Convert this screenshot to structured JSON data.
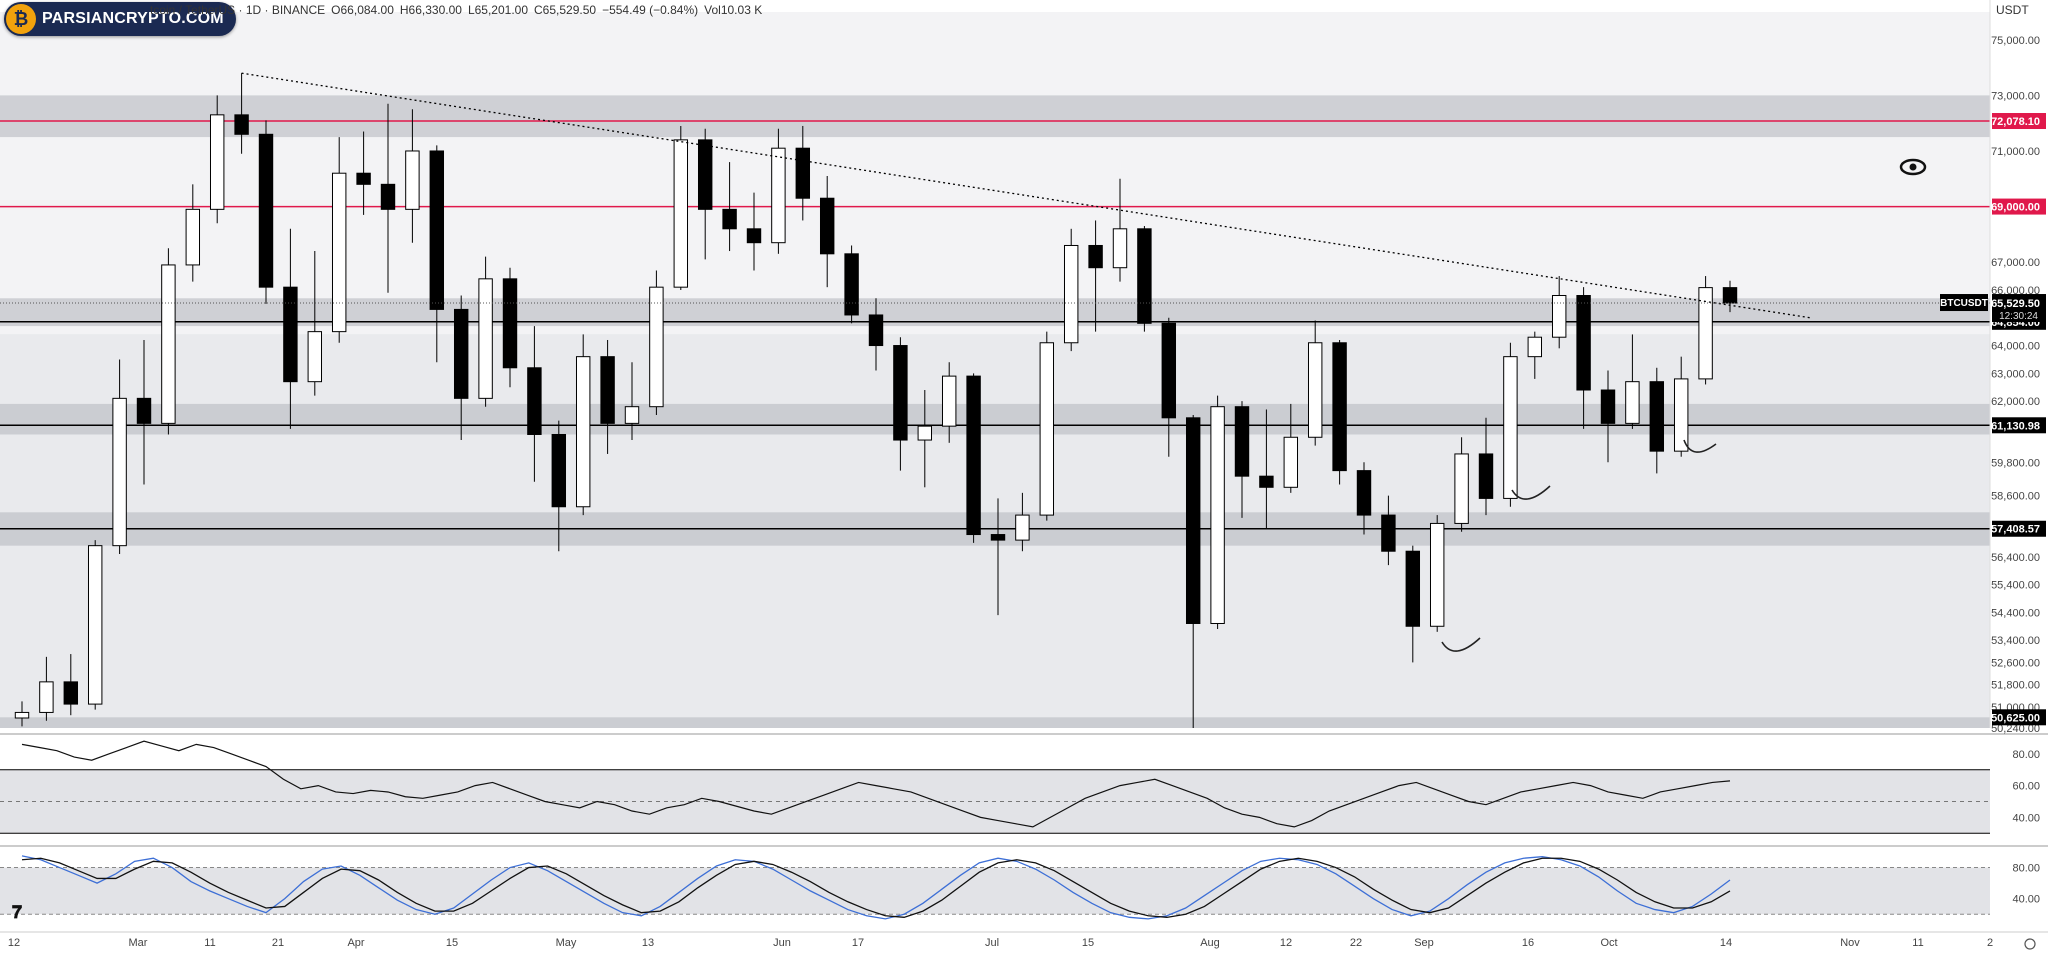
{
  "header": {
    "symbol": "tcoin / TetherUS · 1D · BINANCE",
    "open": "O66,084.00",
    "high": "H66,330.00",
    "low": "L65,201.00",
    "close": "C65,529.50",
    "change": "−554.49 (−0.84%)",
    "volume": "Vol10.03 K",
    "currency": "USDT"
  },
  "watermark": {
    "text": "PARSIANCRYPTO.COM"
  },
  "colors": {
    "up": "#ffffff",
    "down": "#000000",
    "red_line": "#e0184b",
    "zone": "#b8b9bf",
    "blue": "#3d6fd6"
  },
  "icons": {
    "eye": "eye-icon",
    "logo": "tradingview-logo-icon",
    "settings": "settings-icon"
  },
  "chart_data": [
    {
      "type": "candlestick",
      "symbol": "BTCUSDT",
      "timeframe": "1D",
      "ylim": [
        50240,
        76000
      ],
      "y_ticks": [
        "75,000.00",
        "73,000.00",
        "71,000.00",
        "67,000.00",
        "66,000.00",
        "64,000.00",
        "63,000.00",
        "62,000.00",
        "59,800.00",
        "58,600.00",
        "56,400.00",
        "55,400.00",
        "54,400.00",
        "53,400.00",
        "52,600.00",
        "51,800.00",
        "51,000.00",
        "50,240.00"
      ],
      "x_ticks": [
        "12",
        "Mar",
        "11",
        "21",
        "Apr",
        "15",
        "May",
        "13",
        "Jun",
        "17",
        "Jul",
        "15",
        "Aug",
        "12",
        "22",
        "Sep",
        "16",
        "Oct",
        "14",
        "Nov",
        "11",
        "2"
      ],
      "price_labels": [
        {
          "value": 72078.1,
          "text": "72,078.10",
          "style": "red"
        },
        {
          "value": 69000.0,
          "text": "69,000.00",
          "style": "red"
        },
        {
          "value": 64854.0,
          "text": "64,854.00",
          "style": "black"
        },
        {
          "value": 61130.98,
          "text": "61,130.98",
          "style": "black"
        },
        {
          "value": 57408.57,
          "text": "57,408.57",
          "style": "black"
        },
        {
          "value": 50625.0,
          "text": "50,625.00",
          "style": "black"
        }
      ],
      "current_price": {
        "symbol": "BTCUSDT",
        "value": 65529.5,
        "text": "65,529.50",
        "countdown": "12:30:24"
      },
      "horizontal_lines": [
        {
          "value": 72078.1,
          "color": "red"
        },
        {
          "value": 69000.0,
          "color": "red"
        },
        {
          "value": 64854.0,
          "color": "black"
        },
        {
          "value": 61130.98,
          "color": "black"
        },
        {
          "value": 57408.57,
          "color": "black"
        }
      ],
      "zones": [
        {
          "from": 71500,
          "to": 73000
        },
        {
          "from": 64700,
          "to": 65700
        },
        {
          "from": 60800,
          "to": 61900
        },
        {
          "from": 56800,
          "to": 58000
        },
        {
          "from": 50240,
          "to": 50625
        }
      ],
      "trendline": {
        "from": [
          "Mar 14",
          73800
        ],
        "to": [
          "Oct 20",
          65000
        ]
      },
      "series": [
        {
          "label": "Feb 12",
          "open": 50600,
          "high": 51200,
          "low": 50300,
          "close": 50800
        },
        {
          "label": "Feb 19",
          "open": 50800,
          "high": 52800,
          "low": 50500,
          "close": 51900
        },
        {
          "label": "Feb 24",
          "open": 51900,
          "high": 52900,
          "low": 50700,
          "close": 51100
        },
        {
          "label": "Feb 27",
          "open": 51100,
          "high": 57000,
          "low": 50900,
          "close": 56800
        },
        {
          "label": "Mar 1",
          "open": 56800,
          "high": 63500,
          "low": 56500,
          "close": 62100
        },
        {
          "label": "Mar 4",
          "open": 62100,
          "high": 64200,
          "low": 59000,
          "close": 61200
        },
        {
          "label": "Mar 6",
          "open": 61200,
          "high": 67500,
          "low": 60800,
          "close": 66900
        },
        {
          "label": "Mar 9",
          "open": 66900,
          "high": 69800,
          "low": 66300,
          "close": 68900
        },
        {
          "label": "Mar 12",
          "open": 68900,
          "high": 73000,
          "low": 68400,
          "close": 72300
        },
        {
          "label": "Mar 14",
          "open": 72300,
          "high": 73800,
          "low": 70900,
          "close": 71600
        },
        {
          "label": "Mar 17",
          "open": 71600,
          "high": 72100,
          "low": 65500,
          "close": 66100
        },
        {
          "label": "Mar 20",
          "open": 66100,
          "high": 68200,
          "low": 61000,
          "close": 62700
        },
        {
          "label": "Mar 23",
          "open": 62700,
          "high": 67400,
          "low": 62200,
          "close": 64500
        },
        {
          "label": "Mar 27",
          "open": 64500,
          "high": 71500,
          "low": 64100,
          "close": 70200
        },
        {
          "label": "Apr 1",
          "open": 70200,
          "high": 71700,
          "low": 68700,
          "close": 69800
        },
        {
          "label": "Apr 4",
          "open": 69800,
          "high": 72700,
          "low": 65900,
          "close": 68900
        },
        {
          "label": "Apr 8",
          "open": 68900,
          "high": 72500,
          "low": 67700,
          "close": 71000
        },
        {
          "label": "Apr 12",
          "open": 71000,
          "high": 71200,
          "low": 63400,
          "close": 65300
        },
        {
          "label": "Apr 16",
          "open": 65300,
          "high": 65800,
          "low": 60600,
          "close": 62100
        },
        {
          "label": "Apr 20",
          "open": 62100,
          "high": 67200,
          "low": 61800,
          "close": 66400
        },
        {
          "label": "Apr 24",
          "open": 66400,
          "high": 66800,
          "low": 62500,
          "close": 63200
        },
        {
          "label": "Apr 28",
          "open": 63200,
          "high": 64700,
          "low": 59100,
          "close": 60800
        },
        {
          "label": "May 1",
          "open": 60800,
          "high": 61300,
          "low": 56600,
          "close": 58200
        },
        {
          "label": "May 4",
          "open": 58200,
          "high": 64400,
          "low": 57900,
          "close": 63600
        },
        {
          "label": "May 8",
          "open": 63600,
          "high": 64200,
          "low": 60100,
          "close": 61200
        },
        {
          "label": "May 12",
          "open": 61200,
          "high": 63400,
          "low": 60600,
          "close": 61800
        },
        {
          "label": "May 16",
          "open": 61800,
          "high": 66700,
          "low": 61500,
          "close": 66100
        },
        {
          "label": "May 20",
          "open": 66100,
          "high": 71900,
          "low": 66000,
          "close": 71400
        },
        {
          "label": "May 23",
          "open": 71400,
          "high": 71800,
          "low": 67100,
          "close": 68900
        },
        {
          "label": "May 27",
          "open": 68900,
          "high": 70600,
          "low": 67400,
          "close": 68200
        },
        {
          "label": "May 31",
          "open": 68200,
          "high": 69500,
          "low": 66700,
          "close": 67700
        },
        {
          "label": "Jun 4",
          "open": 67700,
          "high": 71800,
          "low": 67300,
          "close": 71100
        },
        {
          "label": "Jun 7",
          "open": 71100,
          "high": 71900,
          "low": 68500,
          "close": 69300
        },
        {
          "label": "Jun 11",
          "open": 69300,
          "high": 70100,
          "low": 66100,
          "close": 67300
        },
        {
          "label": "Jun 15",
          "open": 67300,
          "high": 67600,
          "low": 64800,
          "close": 65100
        },
        {
          "label": "Jun 19",
          "open": 65100,
          "high": 65700,
          "low": 63100,
          "close": 64000
        },
        {
          "label": "Jun 23",
          "open": 64000,
          "high": 64300,
          "low": 59500,
          "close": 60600
        },
        {
          "label": "Jun 27",
          "open": 60600,
          "high": 62400,
          "low": 58900,
          "close": 61100
        },
        {
          "label": "Jul 1",
          "open": 61100,
          "high": 63400,
          "low": 60500,
          "close": 62900
        },
        {
          "label": "Jul 4",
          "open": 62900,
          "high": 63000,
          "low": 56900,
          "close": 57200
        },
        {
          "label": "Jul 8",
          "open": 57200,
          "high": 58500,
          "low": 54300,
          "close": 57000
        },
        {
          "label": "Jul 12",
          "open": 57000,
          "high": 58700,
          "low": 56600,
          "close": 57900
        },
        {
          "label": "Jul 16",
          "open": 57900,
          "high": 64500,
          "low": 57700,
          "close": 64100
        },
        {
          "label": "Jul 20",
          "open": 64100,
          "high": 68200,
          "low": 63800,
          "close": 67600
        },
        {
          "label": "Jul 24",
          "open": 67600,
          "high": 68500,
          "low": 64500,
          "close": 66800
        },
        {
          "label": "Jul 28",
          "open": 66800,
          "high": 70000,
          "low": 66300,
          "close": 68200
        },
        {
          "label": "Jul 31",
          "open": 68200,
          "high": 68300,
          "low": 64500,
          "close": 64800
        },
        {
          "label": "Aug 2",
          "open": 64800,
          "high": 65000,
          "low": 60000,
          "close": 61400
        },
        {
          "label": "Aug 5",
          "open": 61400,
          "high": 61500,
          "low": 50240,
          "close": 54000
        },
        {
          "label": "Aug 8",
          "open": 54000,
          "high": 62200,
          "low": 53800,
          "close": 61800
        },
        {
          "label": "Aug 12",
          "open": 61800,
          "high": 62000,
          "low": 57800,
          "close": 59300
        },
        {
          "label": "Aug 16",
          "open": 59300,
          "high": 61700,
          "low": 57400,
          "close": 58900
        },
        {
          "label": "Aug 20",
          "open": 58900,
          "high": 61900,
          "low": 58700,
          "close": 60700
        },
        {
          "label": "Aug 24",
          "open": 60700,
          "high": 64900,
          "low": 60400,
          "close": 64100
        },
        {
          "label": "Aug 27",
          "open": 64100,
          "high": 64200,
          "low": 59000,
          "close": 59500
        },
        {
          "label": "Aug 31",
          "open": 59500,
          "high": 59800,
          "low": 57200,
          "close": 57900
        },
        {
          "label": "Sep 4",
          "open": 57900,
          "high": 58600,
          "low": 56100,
          "close": 56600
        },
        {
          "label": "Sep 7",
          "open": 56600,
          "high": 56800,
          "low": 52600,
          "close": 53900
        },
        {
          "label": "Sep 10",
          "open": 53900,
          "high": 57900,
          "low": 53700,
          "close": 57600
        },
        {
          "label": "Sep 14",
          "open": 57600,
          "high": 60700,
          "low": 57300,
          "close": 60100
        },
        {
          "label": "Sep 18",
          "open": 60100,
          "high": 61400,
          "low": 57900,
          "close": 58500
        },
        {
          "label": "Sep 21",
          "open": 58500,
          "high": 64100,
          "low": 58200,
          "close": 63600
        },
        {
          "label": "Sep 25",
          "open": 63600,
          "high": 64500,
          "low": 62800,
          "close": 64300
        },
        {
          "label": "Sep 28",
          "open": 64300,
          "high": 66500,
          "low": 63900,
          "close": 65800
        },
        {
          "label": "Oct 1",
          "open": 65800,
          "high": 66100,
          "low": 61000,
          "close": 62400
        },
        {
          "label": "Oct 4",
          "open": 62400,
          "high": 63100,
          "low": 59800,
          "close": 61200
        },
        {
          "label": "Oct 7",
          "open": 61200,
          "high": 64400,
          "low": 61000,
          "close": 62700
        },
        {
          "label": "Oct 10",
          "open": 62700,
          "high": 63200,
          "low": 59400,
          "close": 60200
        },
        {
          "label": "Oct 12",
          "open": 60200,
          "high": 63600,
          "low": 60000,
          "close": 62800
        },
        {
          "label": "Oct 14",
          "open": 62800,
          "high": 66500,
          "low": 62600,
          "close": 66084
        },
        {
          "label": "Oct 15",
          "open": 66084,
          "high": 66330,
          "low": 65201,
          "close": 65529.5
        }
      ]
    },
    {
      "type": "line",
      "name": "RSI",
      "ylim": [
        27,
        90
      ],
      "y_ticks": [
        "80.00",
        "60.00",
        "40.00"
      ],
      "bands": [
        70,
        30
      ],
      "midline": 50,
      "values": [
        86,
        84,
        82,
        78,
        76,
        80,
        84,
        88,
        85,
        82,
        86,
        84,
        80,
        76,
        72,
        64,
        58,
        60,
        56,
        55,
        57,
        56,
        53,
        52,
        54,
        56,
        60,
        62,
        58,
        54,
        50,
        48,
        46,
        50,
        48,
        44,
        42,
        46,
        48,
        52,
        50,
        47,
        44,
        42,
        46,
        50,
        54,
        58,
        62,
        60,
        58,
        56,
        52,
        48,
        44,
        40,
        38,
        36,
        34,
        40,
        46,
        52,
        56,
        60,
        62,
        64,
        60,
        56,
        52,
        46,
        42,
        40,
        36,
        34,
        38,
        44,
        48,
        52,
        56,
        60,
        62,
        58,
        54,
        50,
        48,
        52,
        56,
        58,
        60,
        62,
        60,
        56,
        54,
        52,
        56,
        58,
        60,
        62,
        63
      ]
    },
    {
      "type": "line",
      "name": "Stoch RSI",
      "ylim": [
        10,
        100
      ],
      "y_ticks": [
        "80.00",
        "40.00"
      ],
      "bands": [
        80,
        20
      ],
      "series": [
        {
          "name": "K",
          "values": [
            95,
            90,
            80,
            70,
            60,
            72,
            88,
            92,
            80,
            62,
            50,
            40,
            30,
            22,
            40,
            62,
            78,
            82,
            70,
            54,
            38,
            26,
            20,
            28,
            46,
            64,
            80,
            86,
            76,
            62,
            48,
            34,
            22,
            18,
            30,
            48,
            66,
            82,
            90,
            88,
            78,
            64,
            50,
            38,
            26,
            18,
            14,
            20,
            34,
            52,
            70,
            86,
            92,
            88,
            78,
            64,
            48,
            34,
            22,
            16,
            14,
            18,
            28,
            44,
            60,
            76,
            88,
            92,
            90,
            84,
            72,
            56,
            40,
            26,
            18,
            24,
            40,
            58,
            74,
            86,
            92,
            94,
            90,
            82,
            68,
            50,
            34,
            26,
            22,
            30,
            46,
            64
          ]
        },
        {
          "name": "D",
          "values": [
            90,
            92,
            86,
            76,
            66,
            66,
            78,
            88,
            86,
            74,
            60,
            48,
            38,
            28,
            30,
            48,
            66,
            78,
            76,
            64,
            48,
            34,
            24,
            24,
            34,
            50,
            66,
            80,
            82,
            72,
            58,
            44,
            32,
            22,
            24,
            36,
            54,
            70,
            84,
            88,
            84,
            74,
            62,
            48,
            36,
            26,
            18,
            16,
            24,
            38,
            56,
            74,
            86,
            90,
            86,
            76,
            62,
            48,
            34,
            24,
            18,
            16,
            20,
            30,
            46,
            62,
            78,
            88,
            92,
            88,
            80,
            68,
            52,
            38,
            26,
            22,
            28,
            44,
            60,
            74,
            86,
            92,
            92,
            88,
            78,
            64,
            48,
            36,
            28,
            28,
            36,
            50
          ]
        }
      ]
    }
  ]
}
